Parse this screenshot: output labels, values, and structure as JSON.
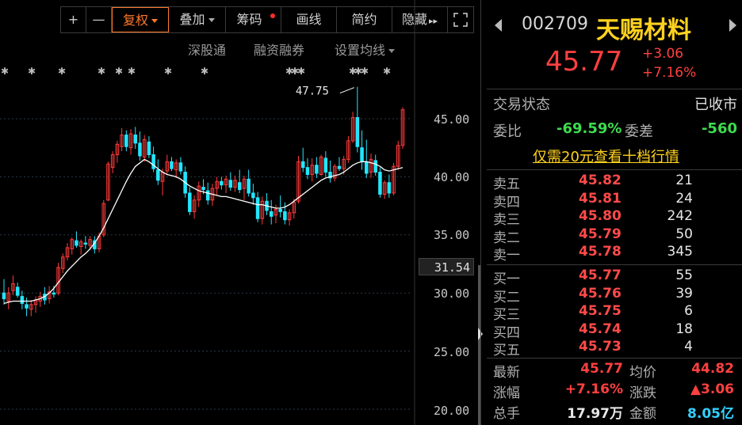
{
  "toolbar": {
    "plus": "+",
    "minus": "—",
    "fuquan": "复权",
    "diejia": "叠加",
    "choumа": "筹码",
    "huaxian": "画线",
    "jianyue": "简约",
    "yincang": "隐藏",
    "yincang_icon": "▸▸"
  },
  "sublinks": {
    "shengutong": "深股通",
    "rongzi": "融资融券",
    "junxian": "设置均线"
  },
  "chart_data": {
    "type": "candlestick",
    "title": "",
    "y_axis_ticks": [
      "45.00",
      "40.00",
      "35.00",
      "30.00",
      "25.00",
      "20.00"
    ],
    "y_values": [
      45,
      40,
      35,
      30,
      25,
      20
    ],
    "current_price_label": "31.54",
    "max_annotation": "47.75",
    "colors": {
      "up": "#ff3a3a",
      "down": "#22e6ff",
      "ma": "#ffffff"
    },
    "candles": [
      {
        "o": 30.0,
        "h": 31.2,
        "l": 29.0,
        "c": 29.5
      },
      {
        "o": 29.3,
        "h": 30.5,
        "l": 28.6,
        "c": 30.0
      },
      {
        "o": 30.2,
        "h": 31.5,
        "l": 29.8,
        "c": 30.8
      },
      {
        "o": 30.5,
        "h": 30.9,
        "l": 29.6,
        "c": 29.8
      },
      {
        "o": 29.7,
        "h": 30.2,
        "l": 28.6,
        "c": 29.1
      },
      {
        "o": 29.0,
        "h": 29.6,
        "l": 28.0,
        "c": 28.7
      },
      {
        "o": 28.6,
        "h": 29.4,
        "l": 28.0,
        "c": 29.0
      },
      {
        "o": 29.0,
        "h": 29.7,
        "l": 28.3,
        "c": 29.4
      },
      {
        "o": 29.3,
        "h": 30.1,
        "l": 28.8,
        "c": 29.7
      },
      {
        "o": 29.9,
        "h": 30.5,
        "l": 29.0,
        "c": 29.4
      },
      {
        "o": 29.5,
        "h": 30.6,
        "l": 29.1,
        "c": 30.1
      },
      {
        "o": 30.0,
        "h": 30.6,
        "l": 29.6,
        "c": 29.9
      },
      {
        "o": 30.0,
        "h": 32.6,
        "l": 29.8,
        "c": 32.2
      },
      {
        "o": 32.1,
        "h": 33.4,
        "l": 31.7,
        "c": 33.1
      },
      {
        "o": 33.1,
        "h": 34.3,
        "l": 32.8,
        "c": 33.9
      },
      {
        "o": 33.8,
        "h": 34.8,
        "l": 33.3,
        "c": 34.6
      },
      {
        "o": 34.5,
        "h": 35.3,
        "l": 33.9,
        "c": 34.1
      },
      {
        "o": 34.0,
        "h": 34.6,
        "l": 33.3,
        "c": 34.4
      },
      {
        "o": 34.3,
        "h": 34.9,
        "l": 33.8,
        "c": 34.2
      },
      {
        "o": 34.1,
        "h": 34.9,
        "l": 33.7,
        "c": 34.6
      },
      {
        "o": 34.5,
        "h": 34.9,
        "l": 33.4,
        "c": 33.8
      },
      {
        "o": 33.8,
        "h": 35.2,
        "l": 33.5,
        "c": 34.9
      },
      {
        "o": 35.0,
        "h": 38.0,
        "l": 34.8,
        "c": 37.7
      },
      {
        "o": 38.0,
        "h": 41.3,
        "l": 37.9,
        "c": 41.1
      },
      {
        "o": 40.8,
        "h": 42.2,
        "l": 40.3,
        "c": 41.9
      },
      {
        "o": 41.9,
        "h": 43.1,
        "l": 41.2,
        "c": 42.8
      },
      {
        "o": 42.6,
        "h": 44.2,
        "l": 42.2,
        "c": 43.6
      },
      {
        "o": 43.6,
        "h": 44.0,
        "l": 42.2,
        "c": 42.6
      },
      {
        "o": 42.5,
        "h": 44.1,
        "l": 41.9,
        "c": 43.7
      },
      {
        "o": 43.6,
        "h": 44.3,
        "l": 42.4,
        "c": 42.9
      },
      {
        "o": 42.9,
        "h": 43.9,
        "l": 41.4,
        "c": 41.8
      },
      {
        "o": 41.7,
        "h": 43.6,
        "l": 41.3,
        "c": 43.2
      },
      {
        "o": 43.0,
        "h": 43.5,
        "l": 41.6,
        "c": 41.9
      },
      {
        "o": 41.9,
        "h": 42.6,
        "l": 40.4,
        "c": 40.7
      },
      {
        "o": 40.6,
        "h": 41.5,
        "l": 39.3,
        "c": 39.7
      },
      {
        "o": 39.6,
        "h": 40.7,
        "l": 38.4,
        "c": 40.4
      },
      {
        "o": 40.5,
        "h": 41.9,
        "l": 40.2,
        "c": 41.3
      },
      {
        "o": 41.3,
        "h": 41.7,
        "l": 40.5,
        "c": 40.7
      },
      {
        "o": 40.6,
        "h": 41.5,
        "l": 39.9,
        "c": 41.2
      },
      {
        "o": 41.2,
        "h": 41.7,
        "l": 40.2,
        "c": 40.5
      },
      {
        "o": 40.4,
        "h": 40.9,
        "l": 38.2,
        "c": 38.6
      },
      {
        "o": 38.6,
        "h": 39.1,
        "l": 36.7,
        "c": 37.0
      },
      {
        "o": 37.0,
        "h": 38.4,
        "l": 36.4,
        "c": 38.0
      },
      {
        "o": 38.0,
        "h": 39.6,
        "l": 37.4,
        "c": 39.2
      },
      {
        "o": 39.1,
        "h": 39.8,
        "l": 38.5,
        "c": 38.9
      },
      {
        "o": 38.8,
        "h": 39.5,
        "l": 37.6,
        "c": 38.0
      },
      {
        "o": 38.0,
        "h": 39.4,
        "l": 37.5,
        "c": 39.0
      },
      {
        "o": 39.0,
        "h": 40.0,
        "l": 38.4,
        "c": 39.6
      },
      {
        "o": 39.6,
        "h": 40.0,
        "l": 38.9,
        "c": 39.3
      },
      {
        "o": 39.3,
        "h": 40.1,
        "l": 38.6,
        "c": 39.8
      },
      {
        "o": 39.7,
        "h": 40.4,
        "l": 38.8,
        "c": 39.1
      },
      {
        "o": 39.1,
        "h": 40.1,
        "l": 38.7,
        "c": 39.7
      },
      {
        "o": 39.5,
        "h": 40.6,
        "l": 38.6,
        "c": 38.9
      },
      {
        "o": 39.0,
        "h": 40.1,
        "l": 38.0,
        "c": 39.8
      },
      {
        "o": 39.8,
        "h": 40.6,
        "l": 38.3,
        "c": 38.6
      },
      {
        "o": 38.6,
        "h": 39.4,
        "l": 37.6,
        "c": 38.2
      },
      {
        "o": 38.2,
        "h": 38.7,
        "l": 36.1,
        "c": 36.4
      },
      {
        "o": 36.4,
        "h": 38.3,
        "l": 35.9,
        "c": 37.9
      },
      {
        "o": 37.9,
        "h": 38.6,
        "l": 36.7,
        "c": 37.1
      },
      {
        "o": 37.0,
        "h": 38.0,
        "l": 35.9,
        "c": 36.6
      },
      {
        "o": 36.7,
        "h": 37.6,
        "l": 36.0,
        "c": 37.2
      },
      {
        "o": 37.2,
        "h": 38.4,
        "l": 36.5,
        "c": 37.0
      },
      {
        "o": 37.0,
        "h": 37.8,
        "l": 35.9,
        "c": 36.3
      },
      {
        "o": 36.3,
        "h": 37.2,
        "l": 35.8,
        "c": 36.9
      },
      {
        "o": 36.9,
        "h": 38.1,
        "l": 36.4,
        "c": 37.8
      },
      {
        "o": 37.9,
        "h": 41.8,
        "l": 37.7,
        "c": 41.3
      },
      {
        "o": 41.3,
        "h": 42.5,
        "l": 40.4,
        "c": 40.8
      },
      {
        "o": 40.8,
        "h": 41.6,
        "l": 39.8,
        "c": 40.2
      },
      {
        "o": 40.2,
        "h": 41.6,
        "l": 39.6,
        "c": 41.0
      },
      {
        "o": 41.0,
        "h": 41.7,
        "l": 39.9,
        "c": 40.3
      },
      {
        "o": 40.2,
        "h": 41.9,
        "l": 40.1,
        "c": 41.7
      },
      {
        "o": 41.6,
        "h": 42.2,
        "l": 40.0,
        "c": 40.4
      },
      {
        "o": 40.4,
        "h": 41.4,
        "l": 39.5,
        "c": 39.9
      },
      {
        "o": 39.9,
        "h": 41.1,
        "l": 39.6,
        "c": 40.9
      },
      {
        "o": 40.9,
        "h": 41.7,
        "l": 40.5,
        "c": 40.7
      },
      {
        "o": 40.7,
        "h": 41.8,
        "l": 40.2,
        "c": 41.5
      },
      {
        "o": 41.5,
        "h": 43.5,
        "l": 41.2,
        "c": 43.1
      },
      {
        "o": 43.1,
        "h": 45.6,
        "l": 42.9,
        "c": 45.1
      },
      {
        "o": 45.1,
        "h": 47.75,
        "l": 42.1,
        "c": 42.6
      },
      {
        "o": 42.5,
        "h": 44.0,
        "l": 40.6,
        "c": 41.3
      },
      {
        "o": 41.3,
        "h": 43.2,
        "l": 39.9,
        "c": 40.3
      },
      {
        "o": 40.4,
        "h": 42.0,
        "l": 39.9,
        "c": 41.5
      },
      {
        "o": 41.4,
        "h": 41.9,
        "l": 40.1,
        "c": 40.4
      },
      {
        "o": 40.4,
        "h": 40.8,
        "l": 38.2,
        "c": 38.5
      },
      {
        "o": 38.5,
        "h": 39.7,
        "l": 38.1,
        "c": 39.5
      },
      {
        "o": 39.5,
        "h": 40.2,
        "l": 38.2,
        "c": 38.6
      },
      {
        "o": 38.6,
        "h": 41.2,
        "l": 38.4,
        "c": 40.9
      },
      {
        "o": 40.9,
        "h": 43.1,
        "l": 40.6,
        "c": 42.7
      },
      {
        "o": 42.7,
        "h": 46.0,
        "l": 42.4,
        "c": 45.77
      }
    ],
    "ma": [
      29.1,
      29.2,
      29.3,
      29.3,
      29.3,
      29.3,
      29.3,
      29.4,
      29.5,
      29.7,
      30.0,
      30.4,
      30.9,
      31.4,
      31.9,
      32.3,
      32.7,
      33.1,
      33.4,
      33.8,
      34.3,
      34.9,
      35.6,
      36.4,
      37.2,
      38.0,
      38.8,
      39.6,
      40.3,
      40.9,
      41.2,
      41.5,
      41.3,
      41.0,
      40.7,
      40.4,
      40.2,
      40.1,
      40.0,
      39.8,
      39.5,
      39.2,
      39.0,
      38.8,
      38.7,
      38.6,
      38.5,
      38.4,
      38.3,
      38.3,
      38.2,
      38.1,
      38.0,
      37.9,
      37.8,
      37.7,
      37.6,
      37.6,
      37.5,
      37.4,
      37.3,
      37.3,
      37.4,
      37.6,
      37.9,
      38.2,
      38.5,
      38.8,
      39.1,
      39.4,
      39.7,
      39.9,
      40.0,
      40.1,
      40.2,
      40.4,
      40.7,
      41.0,
      41.2,
      41.3,
      41.3,
      41.2,
      41.1,
      40.9,
      40.6,
      40.5,
      40.6,
      40.7,
      40.8
    ]
  },
  "stock": {
    "code": "002709",
    "name": "天赐材料",
    "price": "45.77",
    "change": "+3.06",
    "change_pct": "+7.16%"
  },
  "status": {
    "label": "交易状态",
    "value": "已收市"
  },
  "weibi": {
    "label": "委比",
    "value": "-69.59%",
    "cha_label": "委差",
    "cha_value": "-560"
  },
  "promo": "仅需20元查看十档行情",
  "asks": [
    {
      "label": "卖五",
      "price": "45.82",
      "vol": "21"
    },
    {
      "label": "卖四",
      "price": "45.81",
      "vol": "24"
    },
    {
      "label": "卖三",
      "price": "45.80",
      "vol": "242"
    },
    {
      "label": "卖二",
      "price": "45.79",
      "vol": "50"
    },
    {
      "label": "卖一",
      "price": "45.78",
      "vol": "345"
    }
  ],
  "bids": [
    {
      "label": "买一",
      "price": "45.77",
      "vol": "55"
    },
    {
      "label": "买二",
      "price": "45.76",
      "vol": "39"
    },
    {
      "label": "买三",
      "price": "45.75",
      "vol": "6"
    },
    {
      "label": "买四",
      "price": "45.74",
      "vol": "18"
    },
    {
      "label": "买五",
      "price": "45.73",
      "vol": "4"
    }
  ],
  "stats": [
    {
      "l1": "最新",
      "v1": "45.77",
      "l2": "均价",
      "v2": "44.82"
    },
    {
      "l1": "涨幅",
      "v1": "+7.16%",
      "l2": "涨跌",
      "v2": "▲3.06"
    },
    {
      "l1": "总手",
      "v1": "17.97万",
      "l2": "金额",
      "v2": "8.05亿"
    }
  ]
}
